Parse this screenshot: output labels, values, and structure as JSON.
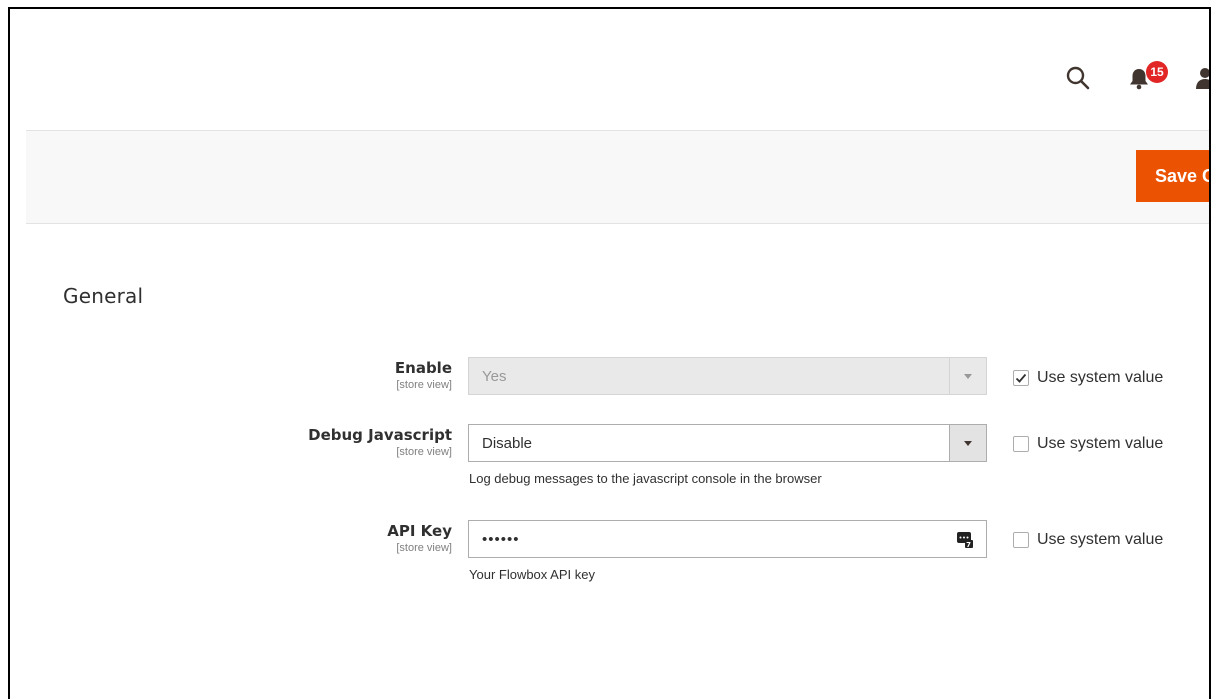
{
  "header": {
    "search_icon": "search-icon",
    "notification_count": "15",
    "bell_icon": "bell-icon",
    "user_icon": "user-icon"
  },
  "actions": {
    "save_label": "Save C"
  },
  "section": {
    "title": "General"
  },
  "fields": [
    {
      "label": "Enable",
      "scope": "[store view]",
      "type": "select",
      "value": "Yes",
      "disabled": true,
      "use_system_value_label": "Use system value",
      "use_system_value_checked": true
    },
    {
      "label": "Debug Javascript",
      "scope": "[store view]",
      "type": "select",
      "value": "Disable",
      "disabled": false,
      "note": "Log debug messages to the javascript console in the browser",
      "use_system_value_label": "Use system value",
      "use_system_value_checked": false
    },
    {
      "label": "API Key",
      "scope": "[store view]",
      "type": "password",
      "value": "••••••",
      "note": "Your Flowbox API key",
      "use_system_value_label": "Use system value",
      "use_system_value_checked": false
    }
  ],
  "colors": {
    "accent": "#eb5202",
    "badge": "#e22626"
  }
}
